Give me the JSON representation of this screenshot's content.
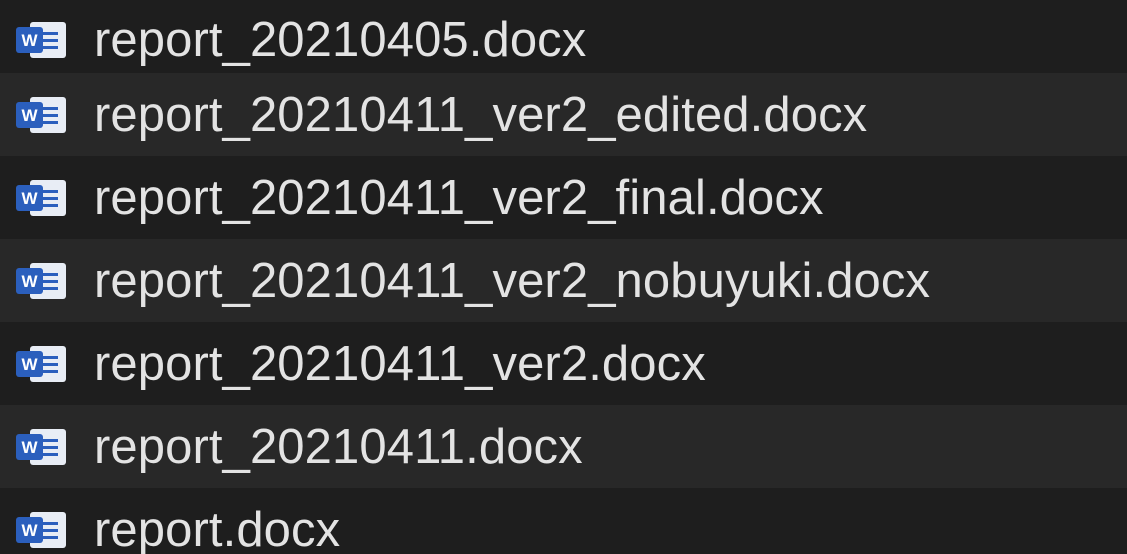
{
  "files": [
    {
      "name": "report_20210405.docx",
      "icon": "word-document-icon"
    },
    {
      "name": "report_20210411_ver2_edited.docx",
      "icon": "word-document-icon"
    },
    {
      "name": "report_20210411_ver2_final.docx",
      "icon": "word-document-icon"
    },
    {
      "name": "report_20210411_ver2_nobuyuki.docx",
      "icon": "word-document-icon"
    },
    {
      "name": "report_20210411_ver2.docx",
      "icon": "word-document-icon"
    },
    {
      "name": "report_20210411.docx",
      "icon": "word-document-icon"
    },
    {
      "name": "report.docx",
      "icon": "word-document-icon"
    }
  ],
  "colors": {
    "row_even": "#1e1e1e",
    "row_odd": "#282828",
    "text": "#e3e3e3",
    "word_blue": "#2b5fbd"
  }
}
